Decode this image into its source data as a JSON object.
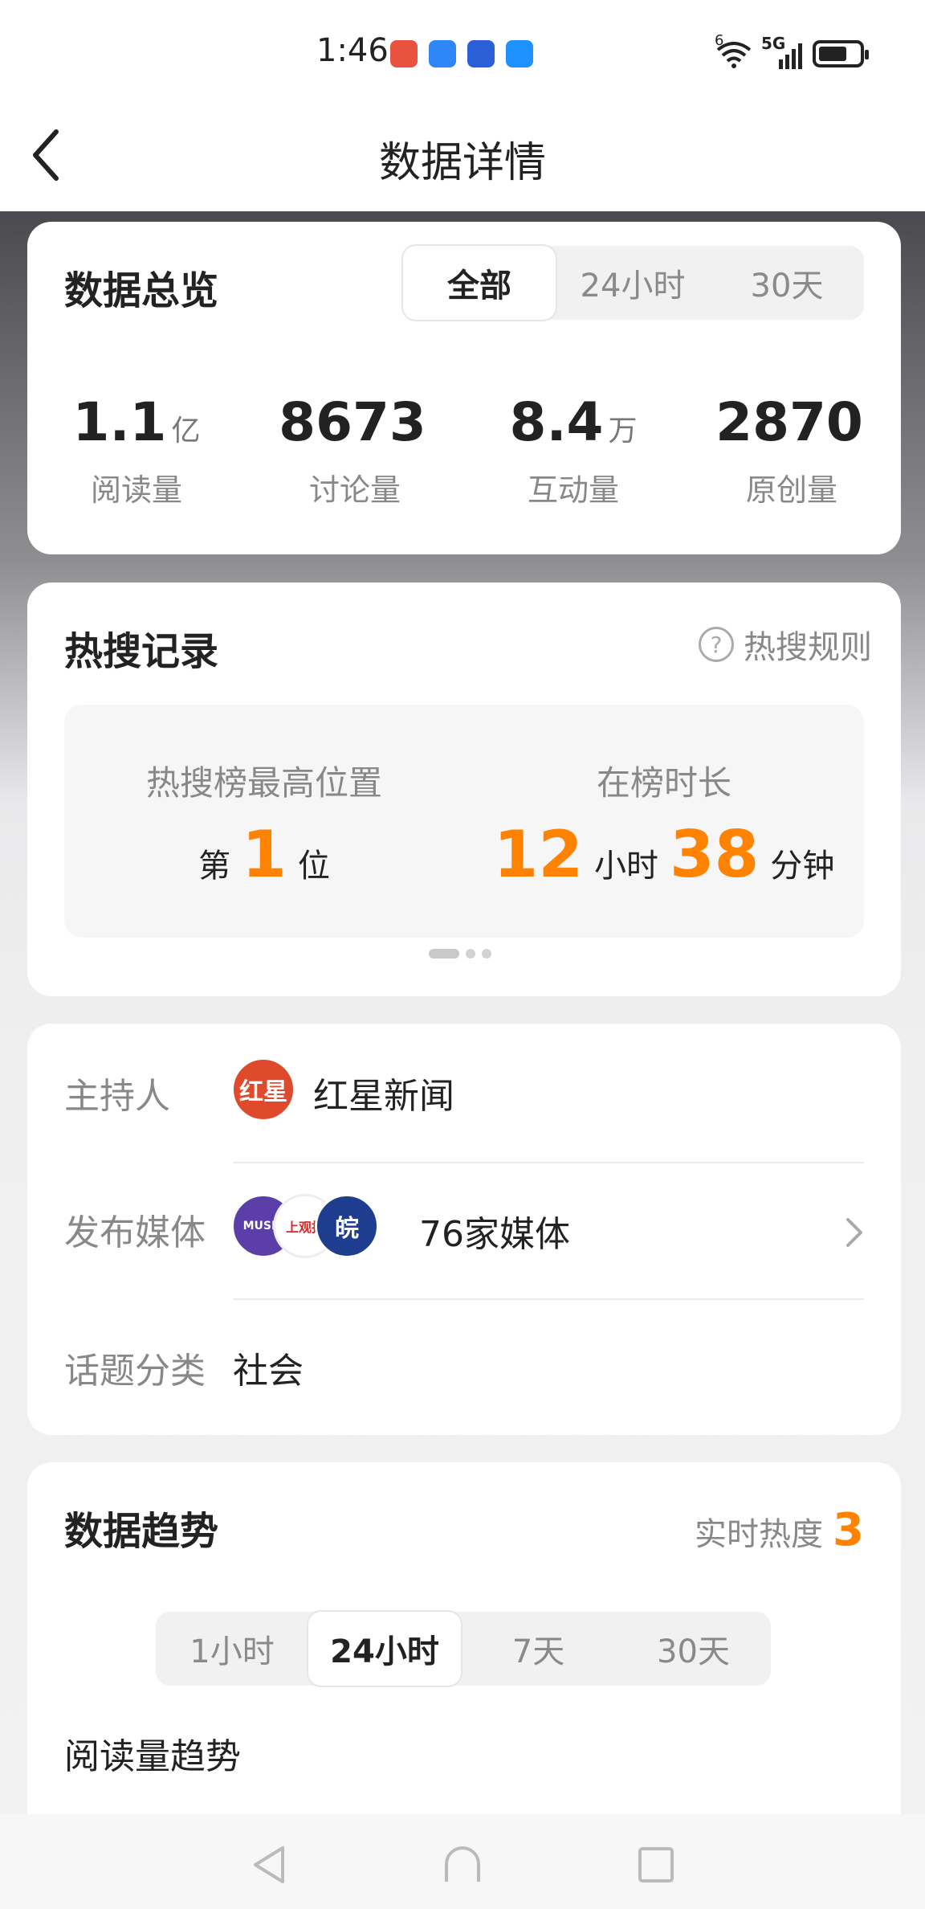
{
  "status_bar": {
    "time": "1:46",
    "app_icons": [
      "missed-call-icon",
      "message-icon",
      "browser-icon",
      "chat-icon"
    ],
    "wifi_label": "6",
    "signal_label": "5G"
  },
  "header": {
    "title": "数据详情"
  },
  "overview": {
    "title": "数据总览",
    "tabs": [
      "全部",
      "24小时",
      "30天"
    ],
    "active_tab": "全部",
    "stats": [
      {
        "value": "1.1",
        "unit": "亿",
        "label": "阅读量"
      },
      {
        "value": "8673",
        "unit": "",
        "label": "讨论量"
      },
      {
        "value": "8.4",
        "unit": "万",
        "label": "互动量"
      },
      {
        "value": "2870",
        "unit": "",
        "label": "原创量"
      }
    ]
  },
  "hot_search": {
    "title": "热搜记录",
    "rules_label": "热搜规则",
    "highest": {
      "label": "热搜榜最高位置",
      "prefix": "第",
      "value": "1",
      "suffix": "位"
    },
    "duration": {
      "label": "在榜时长",
      "hours": "12",
      "hours_unit": "小时",
      "minutes": "38",
      "minutes_unit": "分钟"
    }
  },
  "info": {
    "host_label": "主持人",
    "host_name": "红星新闻",
    "host_avatar_text": "红星",
    "media_label": "发布媒体",
    "media_count": "76家媒体",
    "media_avatar_texts": [
      "MUSIC",
      "上观报",
      "皖"
    ],
    "category_label": "话题分类",
    "category_value": "社会"
  },
  "trend": {
    "title": "数据趋势",
    "realtime_label": "实时热度",
    "realtime_value": "3",
    "tabs": [
      "1小时",
      "24小时",
      "7天",
      "30天"
    ],
    "active_tab": "24小时",
    "subtitle": "阅读量趋势"
  },
  "colors": {
    "accent_orange": "#ff8200",
    "card_bg": "#ffffff",
    "muted_text": "#888888"
  }
}
